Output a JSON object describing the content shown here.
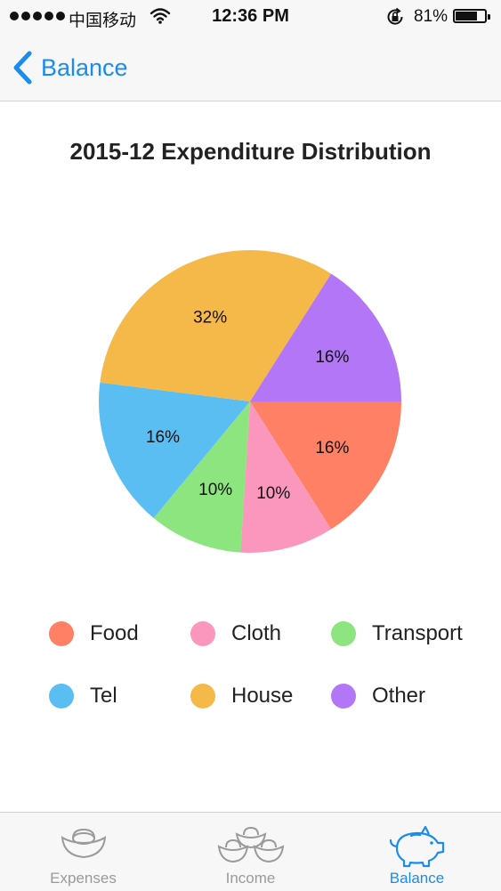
{
  "status_bar": {
    "carrier": "中国移动",
    "time": "12:36 PM",
    "battery": "81%",
    "battery_level": 0.81
  },
  "nav": {
    "back_label": "Balance"
  },
  "chart_data": {
    "type": "pie",
    "title": "2015-12 Expenditure Distribution",
    "legend_position": "bottom",
    "slices": [
      {
        "label": "Food",
        "value": 16,
        "display": "16%",
        "color": "#ff8064"
      },
      {
        "label": "Cloth",
        "value": 10,
        "display": "10%",
        "color": "#fb97bd"
      },
      {
        "label": "Transport",
        "value": 10,
        "display": "10%",
        "color": "#8ce57e"
      },
      {
        "label": "Tel",
        "value": 16,
        "display": "16%",
        "color": "#5bbef2"
      },
      {
        "label": "House",
        "value": 32,
        "display": "32%",
        "color": "#f5b94a"
      },
      {
        "label": "Other",
        "value": 16,
        "display": "16%",
        "color": "#b276f7"
      }
    ]
  },
  "tabs": [
    {
      "label": "Expenses",
      "icon": "gold-ingot-icon",
      "active": false
    },
    {
      "label": "Income",
      "icon": "gold-ingots-stack-icon",
      "active": false
    },
    {
      "label": "Balance",
      "icon": "piggy-bank-icon",
      "active": true
    }
  ],
  "colors": {
    "accent": "#1a8cf0",
    "tab_inactive": "#9a9a9a"
  }
}
